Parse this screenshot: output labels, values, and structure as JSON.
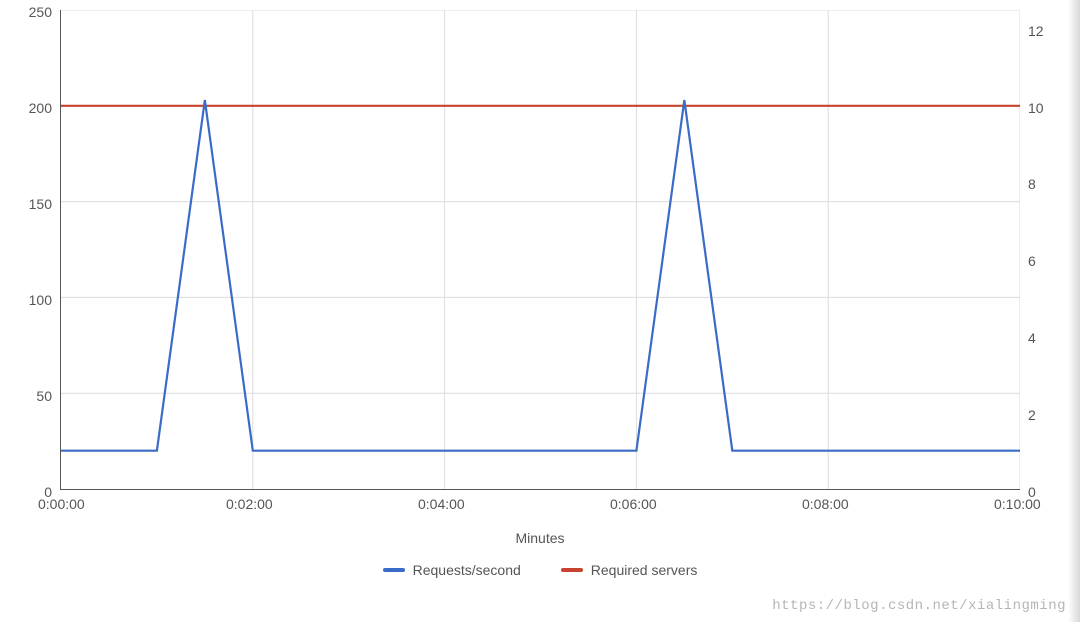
{
  "chart_data": {
    "type": "line",
    "xlabel": "Minutes",
    "x_ticks": [
      "0:00:00",
      "0:02:00",
      "0:04:00",
      "0:06:00",
      "0:08:00",
      "0:10:00"
    ],
    "y_left": {
      "label": "",
      "min": 0,
      "max": 250,
      "ticks": [
        0,
        50,
        100,
        150,
        200,
        250
      ]
    },
    "y_right": {
      "label": "",
      "min": 0,
      "max": 12.5,
      "ticks": [
        0,
        2,
        4,
        6,
        8,
        10,
        12
      ]
    },
    "x_minutes": [
      0,
      1,
      1.5,
      2,
      3,
      4,
      5,
      6,
      6.5,
      7,
      8,
      9,
      10
    ],
    "series": [
      {
        "name": "Requests/second",
        "axis": "left",
        "color": "#3a6cc7",
        "values": [
          20,
          20,
          203,
          20,
          20,
          20,
          20,
          20,
          203,
          20,
          20,
          20,
          20
        ]
      },
      {
        "name": "Required servers",
        "axis": "right",
        "color": "#c7432d",
        "values": [
          10,
          10,
          10,
          10,
          10,
          10,
          10,
          10,
          10,
          10,
          10,
          10,
          10
        ]
      }
    ]
  },
  "legend": {
    "requests": "Requests/second",
    "servers": "Required servers"
  },
  "axis": {
    "xlabel": "Minutes",
    "left_0": "0",
    "left_50": "50",
    "left_100": "100",
    "left_150": "150",
    "left_200": "200",
    "left_250": "250",
    "right_0": "0",
    "right_2": "2",
    "right_4": "4",
    "right_6": "6",
    "right_8": "8",
    "right_10": "10",
    "right_12": "12",
    "x_0": "0:00:00",
    "x_2": "0:02:00",
    "x_4": "0:04:00",
    "x_6": "0:06:00",
    "x_8": "0:08:00",
    "x_10": "0:10:00"
  },
  "watermark": "https://blog.csdn.net/xialingming"
}
